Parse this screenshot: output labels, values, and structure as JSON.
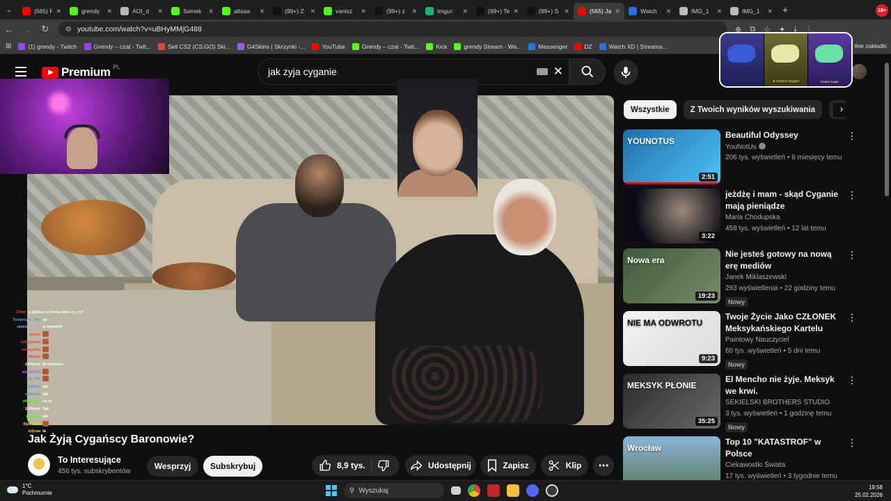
{
  "browser": {
    "tabs": [
      {
        "label": "(565) R",
        "fav": "#ff0000"
      },
      {
        "label": "grendy",
        "fav": "#53fc18"
      },
      {
        "label": "AOI_d",
        "fav": "#bbbbbb"
      },
      {
        "label": "Samek",
        "fav": "#53fc18"
      },
      {
        "label": "altaaa",
        "fav": "#53fc18"
      },
      {
        "label": "(99+) Z",
        "fav": "#111111"
      },
      {
        "label": "vanisz",
        "fav": "#53fc18"
      },
      {
        "label": "(99+) z",
        "fav": "#111111"
      },
      {
        "label": "Imgur:",
        "fav": "#1bb76e"
      },
      {
        "label": "(99+) Te",
        "fav": "#111111"
      },
      {
        "label": "(99+) S",
        "fav": "#111111"
      },
      {
        "label": "(565) Ja",
        "fav": "#ff0000",
        "active": true
      },
      {
        "label": "Watch",
        "fav": "#2b6fe6"
      },
      {
        "label": "IMG_1",
        "fav": "#bbbbbb"
      },
      {
        "label": "IMG_1",
        "fav": "#bbbbbb"
      }
    ],
    "profile_badge": "18+",
    "url": "youtube.com/watch?v=uBHyMMjG488",
    "bookmarks": [
      {
        "label": "(1) grendy - Twitch",
        "color": "#9146ff"
      },
      {
        "label": "Grendy – czat - Twit...",
        "color": "#9146ff"
      },
      {
        "label": "Sell CS2 (CS:GO) Ski...",
        "color": "#e34234"
      },
      {
        "label": "G4Skins | Skrzynki -...",
        "color": "#9b59ff"
      },
      {
        "label": "YouTube",
        "color": "#ff0000"
      },
      {
        "label": "Grendy – czat - Twit...",
        "color": "#53fc18"
      },
      {
        "label": "Kick",
        "color": "#53fc18"
      },
      {
        "label": "grendy Stream - Wa...",
        "color": "#53fc18"
      },
      {
        "label": "Messenger",
        "color": "#1877f2"
      },
      {
        "label": "DZ",
        "color": "#ff0000"
      },
      {
        "label": "Watch XD | Streama...",
        "color": "#2b6fe6"
      }
    ],
    "bookmarks_right": "tkie zakładki"
  },
  "youtube": {
    "logo_text": "Premium",
    "country": "PL",
    "search_query": "jak zyja cyganie",
    "video": {
      "title": "Jak Żyją Cygańscy Baronowie?",
      "channel": "To Interesujące",
      "subscribers": "456 tys. subskrybentów",
      "support_label": "Wesprzyj",
      "subscribe_label": "Subskrybuj",
      "likes": "8,9 tys.",
      "share_label": "Udostępnij",
      "save_label": "Zapisz",
      "clip_label": "Klip"
    },
    "chips": [
      "Wszystkie",
      "Z Twoich wyników wyszukiwania",
      "Z"
    ],
    "recommendations": [
      {
        "title": "Beautiful Odyssey",
        "channel": "YouNotUs",
        "verified": true,
        "meta": "206 tys. wyświetleń • 6 miesięcy temu",
        "duration": "2:51",
        "badge": "",
        "thumb": "linear-gradient(135deg,#1f6fa8,#4fc3f7)",
        "thumb_text": "YOUNOTUS",
        "progress": 1.0
      },
      {
        "title": "jeżdżę i mam - skąd Cyganie mają pieniądze",
        "channel": "Maria Chodupska",
        "verified": false,
        "meta": "458 tys. wyświetleń • 12 lat temu",
        "duration": "3:22",
        "badge": "",
        "thumb": "radial-gradient(circle at 60% 40%,#9a8a7a,#0a0a14 70%)",
        "thumb_text": "",
        "progress": 0
      },
      {
        "title": "Nie jesteś gotowy na nową erę mediów społecznościowych",
        "channel": "Janek Miklaszewski",
        "verified": false,
        "meta": "293 wyświetlenia • 22 godziny temu",
        "duration": "19:23",
        "badge": "Nowy",
        "thumb": "linear-gradient(135deg,#3c5a3a,#7a8a6a)",
        "thumb_text": "Nowa era",
        "progress": 0
      },
      {
        "title": "Twoje Życie Jako CZŁONEK Meksykańskiego Kartelu (Każ...",
        "channel": "Paintowy Nauczyciel",
        "verified": false,
        "meta": "60 tys. wyświetleń • 5 dni temu",
        "duration": "9:23",
        "badge": "Nowy",
        "thumb": "linear-gradient(135deg,#f2f2f2,#dcdcdc)",
        "thumb_text": "NIE MA ODWROTU",
        "progress": 0
      },
      {
        "title": "El Mencho nie żyje. Meksyk we krwi.",
        "channel": "SEKIELSKI BROTHERS STUDIO",
        "verified": false,
        "meta": "3 tys. wyświetleń • 1 godzinę temu",
        "duration": "35:25",
        "badge": "Nowy",
        "thumb": "linear-gradient(135deg,#2a2a2a,#6a6a6a)",
        "thumb_text": "MEKSYK PŁONIE",
        "progress": 0
      },
      {
        "title": "Top 10 \"KATASTROF\" w Polsce",
        "channel": "Ciekawostki Świata",
        "verified": false,
        "meta": "17 tys. wyświetleń • 3 tygodnie temu",
        "duration": "",
        "badge": "",
        "thumb": "linear-gradient(180deg,#8ab4d8,#5a7a5a)",
        "thumb_text": "Wrocław",
        "progress": 0
      }
    ]
  },
  "stream": {
    "chat": [
      {
        "user": "Chnrr",
        "color": "#ff4040",
        "msg": "a globus to koma wali czy co?",
        "emote": false
      },
      {
        "user": "Towarzysz_Mai",
        "color": "#4aa0ff",
        "msg": "xd",
        "emote": false
      },
      {
        "user": "rzuczek_4wk",
        "color": "#c8a0ff",
        "msg": "w niedziele",
        "emote": false
      },
      {
        "user": "szlaur",
        "color": "#ff3a3a",
        "msg": "",
        "emote": true
      },
      {
        "user": "szlaupokoj",
        "color": "#ff3a3a",
        "msg": "",
        "emote": true
      },
      {
        "user": "szlaupoko",
        "color": "#ff3a3a",
        "msg": "",
        "emote": true
      },
      {
        "user": "szlaupo",
        "color": "#ff3a3a",
        "msg": "",
        "emote": true
      },
      {
        "user": "187hemi",
        "color": "#ffffff",
        "msg": "W niedziele",
        "emote": false
      },
      {
        "user": "alanqa800",
        "color": "#b066ff",
        "msg": "",
        "emote": true
      },
      {
        "user": "Pit_h69",
        "color": "#3aa0ff",
        "msg": "",
        "emote": true
      },
      {
        "user": "pajOrk",
        "color": "#3a9aff",
        "msg": "tak",
        "emote": false
      },
      {
        "user": "miliosxk",
        "color": "#3a9aff",
        "msg": "tak",
        "emote": false
      },
      {
        "user": "oliwierrek",
        "color": "#53fc18",
        "msg": "no ta",
        "emote": false
      },
      {
        "user": "187hemi",
        "color": "#ffffff",
        "msg": "Tak",
        "emote": false
      },
      {
        "user": "Kiper0x",
        "color": "#53fc18",
        "msg": "tak",
        "emote": false
      },
      {
        "user": "lllpumbar",
        "color": "#ffd000",
        "msg": "",
        "emote": true
      },
      {
        "user": "b3jcaa",
        "color": "#ffd000",
        "msg": "ta",
        "emote": false
      }
    ],
    "popup_items": [
      {
        "label": ""
      },
      {
        "label": "★ Gamma Doppler"
      },
      {
        "label": "Desert Eagle"
      }
    ]
  },
  "taskbar": {
    "temperature": "1°C",
    "weather": "Pochmurnie",
    "search_placeholder": "Wyszukaj",
    "time": "19:58",
    "date": "25.02.2026"
  },
  "colors": {
    "accent": "#ff0000",
    "background": "#0f0f0f"
  }
}
